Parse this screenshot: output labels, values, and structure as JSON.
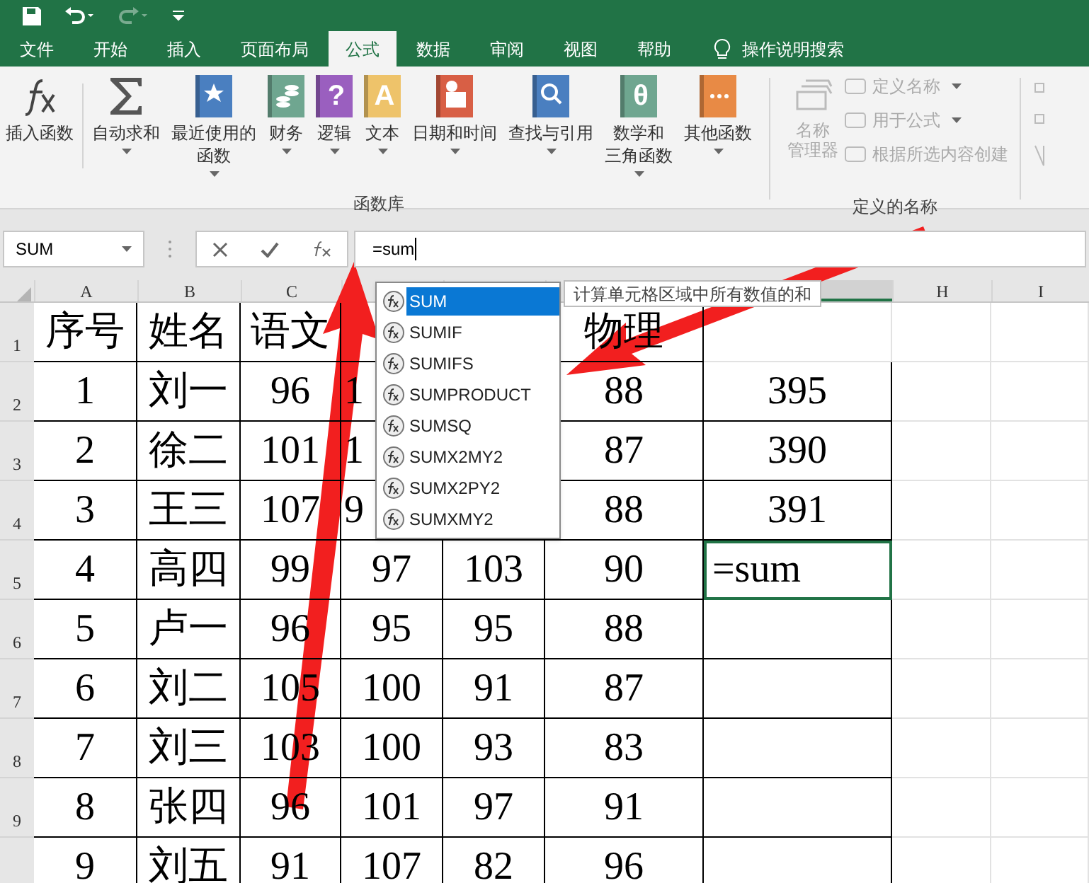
{
  "quick_access": {
    "redo_disabled": true
  },
  "tabs": [
    {
      "label": "文件",
      "selected": false
    },
    {
      "label": "开始",
      "selected": false
    },
    {
      "label": "插入",
      "selected": false
    },
    {
      "label": "页面布局",
      "selected": false
    },
    {
      "label": "公式",
      "selected": true
    },
    {
      "label": "数据",
      "selected": false
    },
    {
      "label": "审阅",
      "selected": false
    },
    {
      "label": "视图",
      "selected": false
    },
    {
      "label": "帮助",
      "selected": false
    }
  ],
  "tell_me": "操作说明搜索",
  "ribbon": {
    "groups": [
      {
        "label": "函数库",
        "buttons": [
          {
            "kind": "fx",
            "lines": [
              "插入函数"
            ],
            "dropdown": false
          },
          {
            "kind": "sigma",
            "lines": [
              "自动求和"
            ],
            "dropdown": true
          },
          {
            "kind": "recent",
            "lines": [
              "最近使用的",
              "函数"
            ],
            "dropdown": true
          },
          {
            "kind": "finance",
            "lines": [
              "财务"
            ],
            "dropdown": true
          },
          {
            "kind": "logic",
            "glyph": "?",
            "lines": [
              "逻辑"
            ],
            "dropdown": true
          },
          {
            "kind": "text",
            "glyph": "A",
            "lines": [
              "文本"
            ],
            "dropdown": true
          },
          {
            "kind": "datetime",
            "lines": [
              "日期和时间"
            ],
            "dropdown": true
          },
          {
            "kind": "lookup",
            "lines": [
              "查找与引用"
            ],
            "dropdown": true
          },
          {
            "kind": "math",
            "glyph": "θ",
            "lines": [
              "数学和",
              "三角函数"
            ],
            "dropdown": true
          },
          {
            "kind": "more",
            "lines": [
              "其他函数"
            ],
            "dropdown": true
          }
        ]
      },
      {
        "label": "定义的名称",
        "big": {
          "lines": [
            "名称",
            "管理器"
          ],
          "disabled": true
        },
        "small": [
          {
            "label": "定义名称",
            "dropdown": true,
            "disabled": true
          },
          {
            "label": "用于公式",
            "dropdown": true,
            "disabled": true
          },
          {
            "label": "根据所选内容创建",
            "dropdown": false,
            "disabled": true
          }
        ]
      }
    ]
  },
  "formula_bar": {
    "name_box": "SUM",
    "formula": "=sum"
  },
  "sheet": {
    "columns": [
      {
        "label": "A",
        "selected": false
      },
      {
        "label": "B",
        "selected": false
      },
      {
        "label": "C",
        "selected": false
      },
      {
        "selected": false
      },
      {
        "selected": false
      },
      {
        "selected": false
      },
      {
        "selected": true
      },
      {
        "label": "H",
        "selected": false
      },
      {
        "label": "I",
        "selected": false
      }
    ],
    "row_numbers": [
      "1",
      "2",
      "3",
      "4",
      "5",
      "6",
      "7",
      "8",
      "9"
    ],
    "rows": [
      {
        "cells": [
          "序号",
          "姓名",
          "语文",
          "",
          "",
          "物理"
        ],
        "total": {
          "active": false
        }
      },
      {
        "cells": [
          "1",
          "刘一",
          "96",
          "1",
          "",
          "88"
        ],
        "total": {
          "text": "395",
          "active": false
        }
      },
      {
        "cells": [
          "2",
          "徐二",
          "101",
          "1",
          "",
          "87"
        ],
        "total": {
          "text": "390",
          "active": false
        }
      },
      {
        "cells": [
          "3",
          "王三",
          "107",
          "9",
          "",
          "88"
        ],
        "total": {
          "text": "391",
          "active": false
        }
      },
      {
        "cells": [
          "4",
          "高四",
          "99",
          "97",
          "103",
          "90"
        ],
        "total": {
          "text": "=sum",
          "active": true
        }
      },
      {
        "cells": [
          "5",
          "卢一",
          "96",
          "95",
          "95",
          "88"
        ],
        "total": {
          "active": false
        }
      },
      {
        "cells": [
          "6",
          "刘二",
          "105",
          "100",
          "91",
          "87"
        ],
        "total": {
          "active": false
        }
      },
      {
        "cells": [
          "7",
          "刘三",
          "103",
          "100",
          "93",
          "83"
        ],
        "total": {
          "active": false
        }
      },
      {
        "cells": [
          "8",
          "张四",
          "96",
          "101",
          "97",
          "91"
        ],
        "total": {
          "active": false
        }
      },
      {
        "cells": [
          "9",
          "刘五",
          "91",
          "107",
          "82",
          "96"
        ],
        "total": {
          "active": false
        }
      }
    ]
  },
  "autocomplete": {
    "items": [
      {
        "label": "SUM",
        "selected": true
      },
      {
        "label": "SUMIF",
        "selected": false
      },
      {
        "label": "SUMIFS",
        "selected": false
      },
      {
        "label": "SUMPRODUCT",
        "selected": false
      },
      {
        "label": "SUMSQ",
        "selected": false
      },
      {
        "label": "SUMX2MY2",
        "selected": false
      },
      {
        "label": "SUMX2PY2",
        "selected": false
      },
      {
        "label": "SUMXMY2",
        "selected": false
      }
    ],
    "tooltip": "计算单元格区域中所有数值的和"
  }
}
